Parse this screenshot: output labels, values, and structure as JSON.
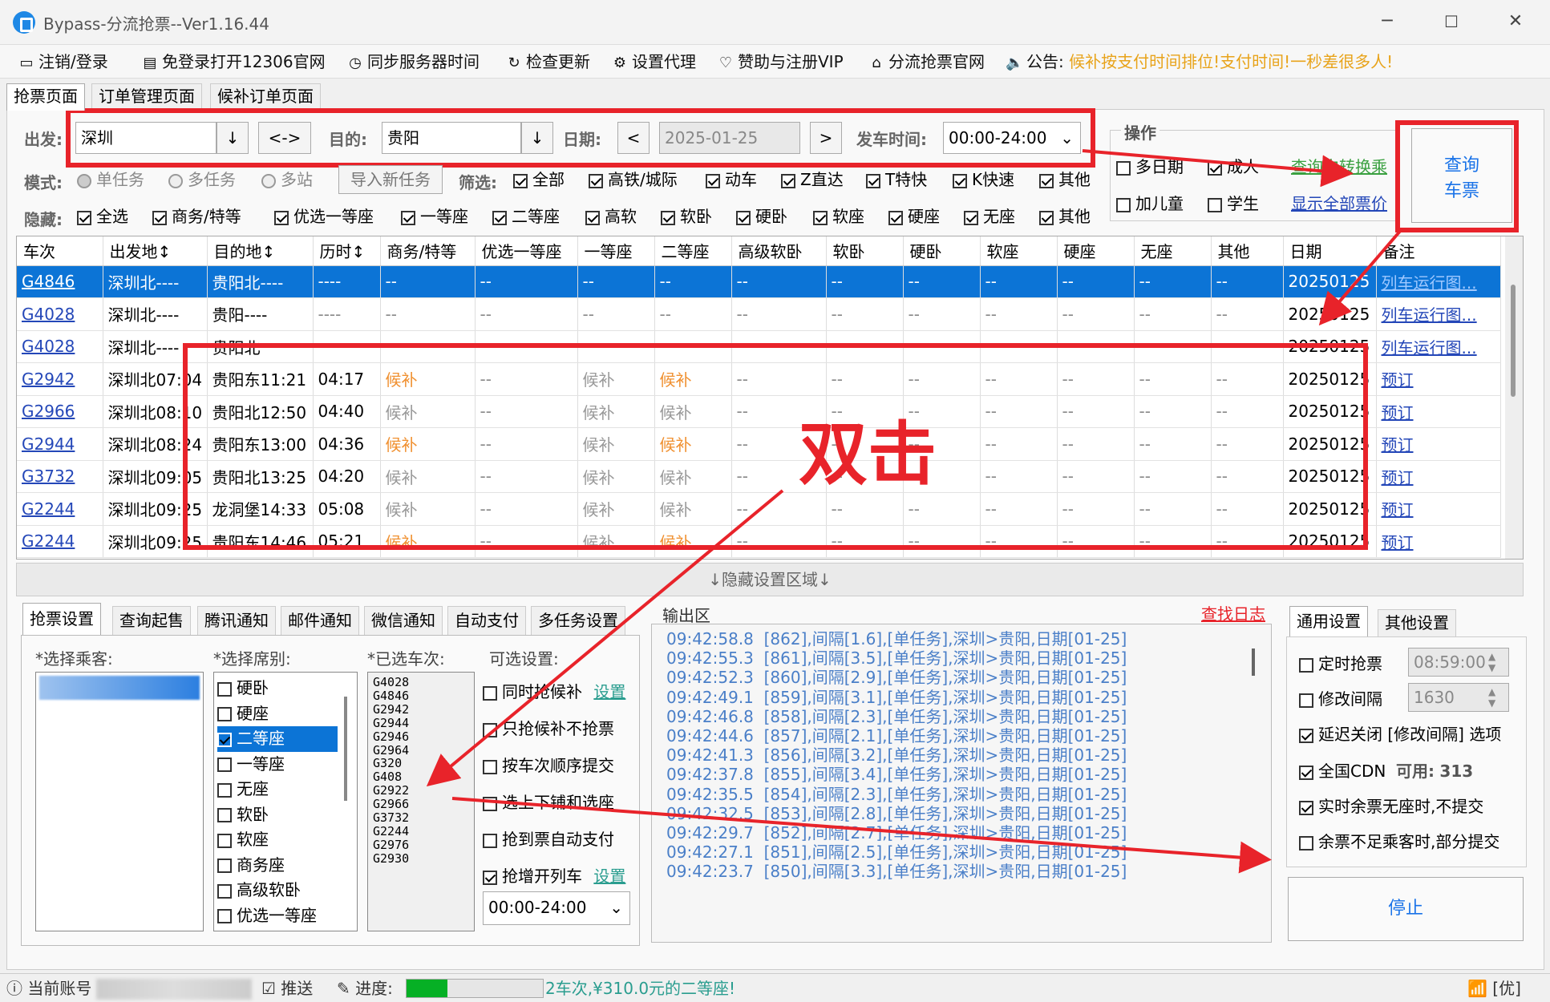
{
  "window": {
    "title": "Bypass-分流抢票--Ver1.16.44",
    "minimize": "─",
    "maximize": "☐",
    "close": "✕"
  },
  "menu": {
    "logout": "注销/登录",
    "open12306": "免登录打开12306官网",
    "sync_time": "同步服务器时间",
    "check_update": "检查更新",
    "proxy": "设置代理",
    "vip": "赞助与注册VIP",
    "site": "分流抢票官网",
    "notice_label": "公告:",
    "notice_text": "候补按支付时间排位!支付时间!一秒差很多人!"
  },
  "tabs": [
    "抢票页面",
    "订单管理页面",
    "候补订单页面"
  ],
  "search": {
    "from_label": "出发:",
    "from_value": "深圳",
    "swap": "<->",
    "to_label": "目的:",
    "to_value": "贵阳",
    "date_label": "日期:",
    "date_value": "2025-01-25",
    "prev": "<",
    "next": ">",
    "time_label": "发车时间:",
    "time_value": "00:00-24:00",
    "down": "↓"
  },
  "mode": {
    "label": "模式:",
    "single": "单任务",
    "multi": "多任务",
    "multistation": "多站",
    "import": "导入新任务",
    "filter_label": "筛选:",
    "filters": [
      "全部",
      "高铁/城际",
      "动车",
      "Z直达",
      "T特快",
      "K快速",
      "其他"
    ]
  },
  "hide": {
    "label": "隐藏:",
    "items": [
      "全选",
      "商务/特等",
      "优选一等座",
      "一等座",
      "二等座",
      "高软",
      "软卧",
      "硬卧",
      "软座",
      "硬座",
      "无座",
      "其他"
    ]
  },
  "ops": {
    "title": "操作",
    "multi_date": "多日期",
    "adult": "成人",
    "switch": "查询中转换乘",
    "child": "加儿童",
    "student": "学生",
    "show_all": "显示全部票价",
    "query_btn_1": "查询",
    "query_btn_2": "车票"
  },
  "grid": {
    "headers": [
      "车次",
      "出发地↕",
      "目的地↕",
      "历时↕",
      "商务/特等",
      "优选一等座",
      "一等座",
      "二等座",
      "高级软卧",
      "软卧",
      "硬卧",
      "软座",
      "硬座",
      "无座",
      "其他",
      "日期",
      "备注"
    ],
    "rows": [
      [
        "G4846",
        "深圳北----",
        "贵阳北----",
        "----",
        "--",
        "--",
        "--",
        "--",
        "--",
        "--",
        "--",
        "--",
        "--",
        "--",
        "--",
        "20250125",
        "列车运行图..."
      ],
      [
        "G4028",
        "深圳北----",
        "贵阳----",
        "----",
        "--",
        "--",
        "--",
        "--",
        "--",
        "--",
        "--",
        "--",
        "--",
        "--",
        "--",
        "20250125",
        "列车运行图..."
      ],
      [
        "G4028",
        "深圳北----",
        "贵阳北",
        "",
        "",
        "",
        "",
        "",
        "",
        "",
        "",
        "",
        "",
        "",
        "",
        "20250125",
        "列车运行图..."
      ],
      [
        "G2942",
        "深圳北07:04",
        "贵阳东11:21",
        "04:17",
        "候补",
        "--",
        "候补",
        "候补",
        "--",
        "--",
        "--",
        "--",
        "--",
        "--",
        "--",
        "20250125",
        "预订"
      ],
      [
        "G2966",
        "深圳北08:10",
        "贵阳北12:50",
        "04:40",
        "候补",
        "--",
        "候补",
        "候补",
        "--",
        "--",
        "--",
        "--",
        "--",
        "--",
        "--",
        "20250125",
        "预订"
      ],
      [
        "G2944",
        "深圳北08:24",
        "贵阳东13:00",
        "04:36",
        "候补",
        "--",
        "候补",
        "候补",
        "--",
        "--",
        "--",
        "--",
        "--",
        "--",
        "--",
        "20250125",
        "预订"
      ],
      [
        "G3732",
        "深圳北09:05",
        "贵阳北13:25",
        "04:20",
        "候补",
        "--",
        "候补",
        "候补",
        "--",
        "--",
        "--",
        "--",
        "--",
        "--",
        "--",
        "20250125",
        "预订"
      ],
      [
        "G2244",
        "深圳北09:25",
        "龙洞堡14:33",
        "05:08",
        "候补",
        "--",
        "候补",
        "候补",
        "--",
        "--",
        "--",
        "--",
        "--",
        "--",
        "--",
        "20250125",
        "预订"
      ],
      [
        "G2244",
        "深圳北09:25",
        "贵阳东14:46",
        "05:21",
        "候补",
        "--",
        "候补",
        "候补",
        "--",
        "--",
        "--",
        "--",
        "--",
        "--",
        "--",
        "20250125",
        "预订"
      ]
    ]
  },
  "dblclick_label": "双击",
  "hidden_area": "↓隐藏设置区域↓",
  "settings_tabs": [
    "抢票设置",
    "查询起售",
    "腾讯通知",
    "邮件通知",
    "微信通知",
    "自动支付",
    "多任务设置"
  ],
  "settings": {
    "passenger_label": "*选择乘客:",
    "seat_label": "*选择席别:",
    "train_label": "*已选车次:",
    "option_label": "可选设置:",
    "seats": [
      {
        "name": "硬卧",
        "on": false
      },
      {
        "name": "硬座",
        "on": false
      },
      {
        "name": "二等座",
        "on": true
      },
      {
        "name": "一等座",
        "on": false
      },
      {
        "name": "无座",
        "on": false
      },
      {
        "name": "软卧",
        "on": false
      },
      {
        "name": "软座",
        "on": false
      },
      {
        "name": "商务座",
        "on": false
      },
      {
        "name": "高级软卧",
        "on": false
      },
      {
        "name": "优选一等座",
        "on": false
      }
    ],
    "trains": [
      "G4028",
      "G4846",
      "G2942",
      "G2944",
      "G2946",
      "G2964",
      "G320",
      "G408",
      "G2922",
      "G2966",
      "G3732",
      "G2244",
      "G2976",
      "G2930"
    ],
    "options": [
      {
        "label": "同时抢候补",
        "on": false,
        "link": "设置"
      },
      {
        "label": "只抢候补不抢票",
        "on": false,
        "link": ""
      },
      {
        "label": "按车次顺序提交",
        "on": false,
        "link": ""
      },
      {
        "label": "选上下铺和选座",
        "on": false,
        "link": ""
      },
      {
        "label": "抢到票自动支付",
        "on": false,
        "link": ""
      },
      {
        "label": "抢增开列车",
        "on": true,
        "link": "设置"
      }
    ],
    "time_range": "00:00-24:00"
  },
  "output": {
    "title": "输出区",
    "find_log": "查找日志",
    "lines": [
      "09:42:58.8  [862],间隔[1.6],[单任务],深圳>贵阳,日期[01-25]",
      "09:42:55.3  [861],间隔[3.5],[单任务],深圳>贵阳,日期[01-25]",
      "09:42:52.3  [860],间隔[2.9],[单任务],深圳>贵阳,日期[01-25]",
      "09:42:49.1  [859],间隔[3.1],[单任务],深圳>贵阳,日期[01-25]",
      "09:42:46.8  [858],间隔[2.3],[单任务],深圳>贵阳,日期[01-25]",
      "09:42:44.6  [857],间隔[2.1],[单任务],深圳>贵阳,日期[01-25]",
      "09:42:41.3  [856],间隔[3.2],[单任务],深圳>贵阳,日期[01-25]",
      "09:42:37.8  [855],间隔[3.4],[单任务],深圳>贵阳,日期[01-25]",
      "09:42:35.5  [854],间隔[2.3],[单任务],深圳>贵阳,日期[01-25]",
      "09:42:32.5  [853],间隔[2.8],[单任务],深圳>贵阳,日期[01-25]",
      "09:42:29.7  [852],间隔[2.7],[单任务],深圳>贵阳,日期[01-25]",
      "09:42:27.1  [851],间隔[2.5],[单任务],深圳>贵阳,日期[01-25]",
      "09:42:23.7  [850],间隔[3.3],[单任务],深圳>贵阳,日期[01-25]"
    ]
  },
  "general": {
    "tabs": [
      "通用设置",
      "其他设置"
    ],
    "timed": "定时抢票",
    "timed_value": "08:59:00",
    "interval": "修改间隔",
    "interval_value": "1630",
    "delay_close": "延迟关闭 [修改间隔] 选项",
    "cdn": "全国CDN",
    "cdn_avail_label": "可用:",
    "cdn_avail": "313",
    "no_seat": "实时余票无座时,不提交",
    "partial": "余票不足乘客时,部分提交",
    "stop": "停止"
  },
  "status": {
    "account": "当前账号",
    "push": "推送",
    "progress_label": "进度:",
    "progress": 0.3,
    "message": "2车次,¥310.0元的二等座!",
    "net": "[优]"
  },
  "colors": {
    "selected_row": "#0c74d6",
    "accent_red": "#e8232a",
    "link": "#2447b8",
    "log": "#4a7fc8",
    "notice": "#e8a31a"
  }
}
